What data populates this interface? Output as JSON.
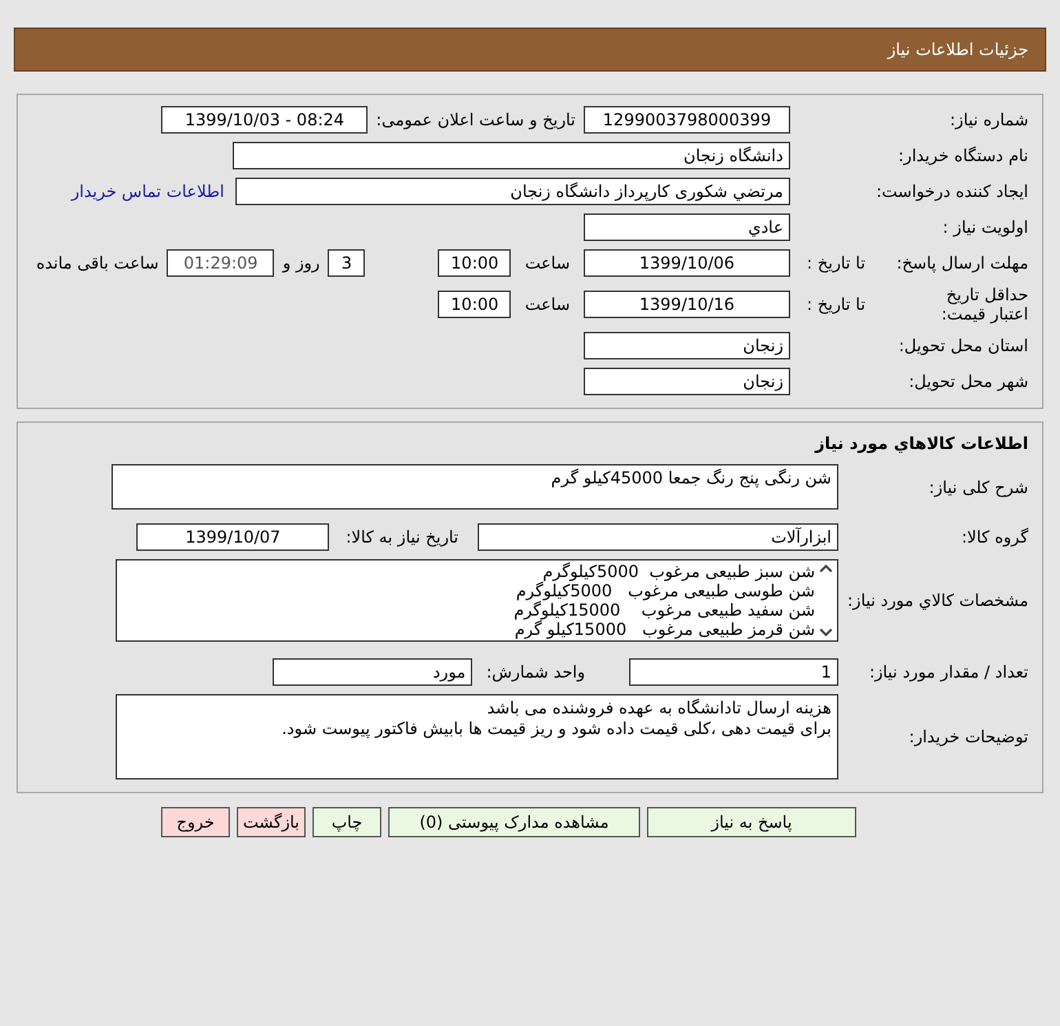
{
  "header": {
    "title": "جزئیات اطلاعات نیاز"
  },
  "need_info": {
    "need_number": {
      "label": "شماره نیاز:",
      "value": "1299003798000399"
    },
    "announce_datetime": {
      "label": "تاریخ و ساعت اعلان عمومی:",
      "value": "1399/10/03 - 08:24"
    },
    "buyer_org": {
      "label": "نام دستگاه خریدار:",
      "value": "دانشگاه زنجان"
    },
    "requester": {
      "label": "ایجاد کننده درخواست:",
      "value": "مرتضي شکوری کارپرداز دانشگاه زنجان",
      "link": "اطلاعات تماس خریدار"
    },
    "priority": {
      "label": "اولویت نیاز :",
      "value": "عادي"
    },
    "response_deadline": {
      "label": "مهلت ارسال پاسخ:",
      "date_label": "تا تاریخ :",
      "date": "1399/10/06",
      "time_label": "ساعت",
      "time": "10:00",
      "days": "3",
      "days_label": "روز و",
      "remaining": "01:29:09",
      "remaining_label": "ساعت باقی مانده"
    },
    "price_validity": {
      "label": "حداقل تاریخ اعتبار قیمت:",
      "date_label": "تا تاریخ :",
      "date": "1399/10/16",
      "time_label": "ساعت",
      "time": "10:00"
    },
    "province": {
      "label": "استان محل تحویل:",
      "value": "زنجان"
    },
    "city": {
      "label": "شهر محل تحویل:",
      "value": "زنجان"
    }
  },
  "goods": {
    "title": "اطلاعات کالاهاي مورد نیاز",
    "description": {
      "label": "شرح کلی نیاز:",
      "value": "شن رنگی پنج رنگ جمعا 45000کیلو گرم"
    },
    "group": {
      "label": "گروه کالا:",
      "value": "ابزارآلات",
      "date_label": "تاریخ نیاز به کالا:",
      "date": "1399/10/07"
    },
    "specs": {
      "label": "مشخصات کالاي مورد نیاز:",
      "lines": [
        "شن سبز طبیعی مرغوب  5000کیلوگرم",
        "شن طوسی طبیعی مرغوب   5000کیلوگرم",
        "شن سفید طبیعی مرغوب    15000کیلوگرم",
        "شن قرمز طبیعی مرغوب   15000کیلو گرم"
      ]
    },
    "quantity": {
      "label": "تعداد / مقدار مورد نیاز:",
      "value": "1",
      "unit_label": "واحد شمارش:",
      "unit": "مورد"
    },
    "notes": {
      "label": "توضیحات خریدار:",
      "lines": [
        "هزینه ارسال تادانشگاه به عهده فروشنده می باشد",
        "برای قیمت دهی ،کلی قیمت داده شود و ریز قیمت ها بابیش فاکتور پیوست شود."
      ]
    }
  },
  "buttons": [
    {
      "label": "پاسخ به نیاز",
      "kind": "action"
    },
    {
      "label": "مشاهده مدارک پیوستی (0)",
      "kind": "action"
    },
    {
      "label": "چاپ",
      "kind": "action"
    },
    {
      "label": "بازگشت",
      "kind": "exit"
    },
    {
      "label": "خروج",
      "kind": "exit"
    }
  ]
}
